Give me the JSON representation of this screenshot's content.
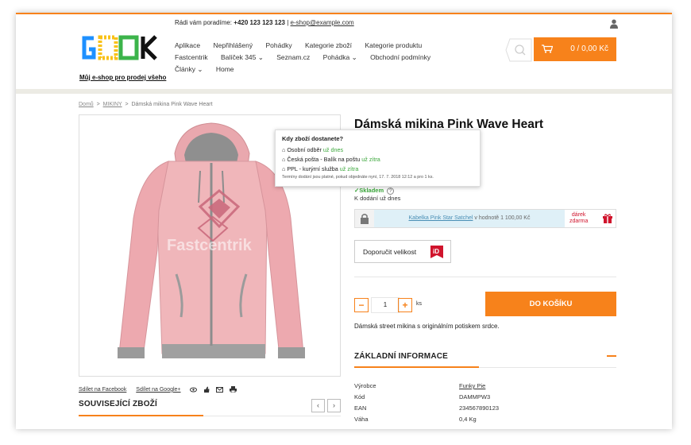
{
  "header": {
    "contact_text": "Rádi vám poradíme:",
    "phone": "+420 123 123 123",
    "separator": "|",
    "email": "e-shop@example.com",
    "tagline": "Můj e-shop pro prodej všeho",
    "logo_text": "GEEK",
    "logo_colors": [
      "#1e90ff",
      "#f9c116",
      "#3cb44b",
      "#e6194b"
    ],
    "nav": [
      {
        "label": "Aplikace"
      },
      {
        "label": "Nepřihlášený"
      },
      {
        "label": "Pohádky"
      },
      {
        "label": "Kategorie zboží"
      },
      {
        "label": "Kategorie produktu"
      },
      {
        "label": "Fastcentrik"
      },
      {
        "label": "Balíček 345 ⌄"
      },
      {
        "label": "Seznam.cz"
      },
      {
        "label": "Pohádka ⌄"
      },
      {
        "label": "Obchodní podmínky"
      },
      {
        "label": "Články ⌄"
      },
      {
        "label": "Home"
      }
    ],
    "cart_label": "0 / 0,00 Kč",
    "accent_color": "#f7821b"
  },
  "breadcrumb": {
    "home": "Domů",
    "category": "MIKINY",
    "current": "Dámská mikina Pink Wave Heart",
    "sep": ">"
  },
  "product": {
    "title": "Dámská mikina Pink Wave Heart",
    "watermark": "Fastcentrik",
    "stock": "Skladem",
    "delivery": "K dodání už dnes",
    "gift": {
      "link": "Kabelka Pink Star Satchel",
      "value": "v hodnotě 1 100,00 Kč",
      "label_line1": "dárek",
      "label_line2": "zdarma"
    },
    "size_button": "Doporučit velikost",
    "size_badge": "iD",
    "quantity": "1",
    "unit": "ks",
    "minus": "−",
    "plus": "+",
    "buy_button": "DO KOŠÍKU",
    "description": "Dámská street mikina s originálním potiskem srdce."
  },
  "popup": {
    "title": "Kdy zboží dostanete?",
    "rows": [
      {
        "name": "Osobní odběr",
        "when": "už dnes"
      },
      {
        "name": "Česká pošta - Balík na poštu",
        "when": "už zítra"
      },
      {
        "name": "PPL - kurýrní služba",
        "when": "už zítra"
      }
    ],
    "note": "Termíny dodání jsou platné, pokud objednáte nyní, 17. 7. 2018 12:12 a pro 1 ks."
  },
  "share": {
    "facebook": "Sdílet na Facebook",
    "google": "Sdílet na Google+"
  },
  "related": {
    "heading": "SOUVISEJÍCÍ ZBOŽÍ",
    "prev": "‹",
    "next": "›"
  },
  "info": {
    "heading": "ZÁKLADNÍ INFORMACE",
    "rows": [
      {
        "label": "Výrobce",
        "value": "Funky Pie"
      },
      {
        "label": "Kód",
        "value": "DAMMPW3"
      },
      {
        "label": "EAN",
        "value": "2345678901​23"
      },
      {
        "label": "Váha",
        "value": "0,4 Kg"
      }
    ]
  }
}
